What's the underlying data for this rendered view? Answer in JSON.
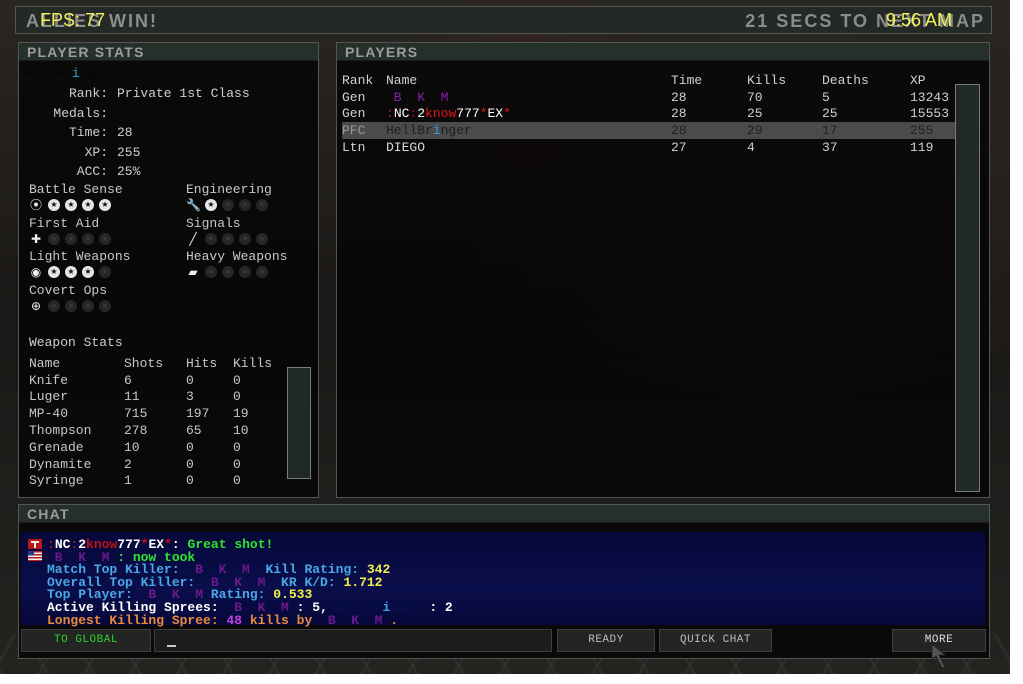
{
  "header": {
    "status_text": "ALLIES WIN!",
    "fps_label": "FPS:",
    "fps_value": "77",
    "next_map_text": "21 SECS TO NEXT MAP",
    "clock": "9:56 AM"
  },
  "player_stats": {
    "title": "PLAYER STATS",
    "player_name_hidden": "HellBr",
    "player_name_i": "i",
    "player_name_rest": "nger",
    "fields": [
      {
        "label": "Rank:",
        "value": "Private 1st Class"
      },
      {
        "label": "Medals:",
        "value": ""
      },
      {
        "label": "Time:",
        "value": "28"
      },
      {
        "label": "XP:",
        "value": "255"
      },
      {
        "label": "ACC:",
        "value": "25%"
      }
    ],
    "skills": [
      {
        "name": "Battle Sense",
        "icon": "radio-signal-icon",
        "glyph": "((•))",
        "level": 4,
        "max": 4
      },
      {
        "name": "Engineering",
        "icon": "wrench-icon",
        "glyph": "🔧",
        "level": 1,
        "max": 4
      },
      {
        "name": "First Aid",
        "icon": "medic-cross-icon",
        "glyph": "✚",
        "level": 0,
        "max": 4
      },
      {
        "name": "Signals",
        "icon": "flare-icon",
        "glyph": "╱",
        "level": 0,
        "max": 4
      },
      {
        "name": "Light Weapons",
        "icon": "pistol-icon",
        "glyph": "◉",
        "level": 3,
        "max": 4
      },
      {
        "name": "Heavy Weapons",
        "icon": "heavy-weapon-icon",
        "glyph": "▰",
        "level": 0,
        "max": 4
      },
      {
        "name": "Covert Ops",
        "icon": "crosshair-icon",
        "glyph": "⊕",
        "level": 0,
        "max": 4
      }
    ],
    "weapon_stats": {
      "title": "Weapon Stats",
      "columns": [
        "Name",
        "Shots",
        "Hits",
        "Kills"
      ],
      "rows": [
        [
          "Knife",
          "6",
          "0",
          "0"
        ],
        [
          "Luger",
          "11",
          "3",
          "0"
        ],
        [
          "MP-40",
          "715",
          "197",
          "19"
        ],
        [
          "Thompson",
          "278",
          "65",
          "10"
        ],
        [
          "Grenade",
          "10",
          "0",
          "0"
        ],
        [
          "Dynamite",
          "2",
          "0",
          "0"
        ],
        [
          "Syringe",
          "1",
          "0",
          "0"
        ]
      ]
    }
  },
  "players": {
    "title": "PLAYERS",
    "columns": [
      "Rank",
      "Name",
      "Time",
      "Kills",
      "Deaths",
      "XP"
    ],
    "rows": [
      {
        "rank": "Gen",
        "name_parts": [
          {
            "t": " B  K  M",
            "c": "#8a1fb0"
          }
        ],
        "time": "28",
        "kills": "70",
        "deaths": "5",
        "xp": "13243",
        "selected": false
      },
      {
        "rank": "Gen",
        "name_parts": [
          {
            "t": ":",
            "c": "#c01010"
          },
          {
            "t": "NC",
            "c": "#ffffff"
          },
          {
            "t": ":",
            "c": "#c01010"
          },
          {
            "t": "2",
            "c": "#ffffff"
          },
          {
            "t": "know",
            "c": "#e01818"
          },
          {
            "t": "777",
            "c": "#ffffff"
          },
          {
            "t": "*",
            "c": "#e01818"
          },
          {
            "t": "EX",
            "c": "#ffffff"
          },
          {
            "t": "*",
            "c": "#e01818"
          }
        ],
        "time": "28",
        "kills": "25",
        "deaths": "25",
        "xp": "15553",
        "selected": false
      },
      {
        "rank": "PFC",
        "name_parts": [
          {
            "t": "HellBr",
            "c": "#1e1e1e"
          },
          {
            "t": "i",
            "c": "#3aa0d8"
          },
          {
            "t": "nger",
            "c": "#1e1e1e"
          }
        ],
        "time": "28",
        "kills": "29",
        "deaths": "17",
        "xp": "255",
        "selected": true
      },
      {
        "rank": "Ltn",
        "name_parts": [
          {
            "t": "DIEGO",
            "c": "#d8d8d8"
          }
        ],
        "time": "27",
        "kills": "4",
        "deaths": "37",
        "xp": "119",
        "selected": false
      }
    ]
  },
  "chat": {
    "title": "CHAT",
    "lines": [
      {
        "parts": [
          {
            "t": ":",
            "c": "#c01010"
          },
          {
            "t": "NC",
            "c": "#ffffff"
          },
          {
            "t": ":",
            "c": "#c01010"
          },
          {
            "t": "2",
            "c": "#ffffff"
          },
          {
            "t": "know",
            "c": "#c01010"
          },
          {
            "t": "777",
            "c": "#ffffff"
          },
          {
            "t": "*",
            "c": "#c01010"
          },
          {
            "t": "EX",
            "c": "#ffffff"
          },
          {
            "t": "*",
            "c": "#c01010"
          },
          {
            "t": ": ",
            "c": "#ffffff"
          },
          {
            "t": "Great shot!",
            "c": "#2ee62e"
          }
        ]
      },
      {
        "parts": [
          {
            "t": " B  K  M ",
            "c": "#6a1a8a"
          },
          {
            "t": ": now took",
            "c": "#2ee62e"
          }
        ]
      },
      {
        "parts": [
          {
            "t": "Match Top Killer: ",
            "c": "#4aa8e8"
          },
          {
            "t": " B  K  M ",
            "c": "#6a1a8a"
          },
          {
            "t": " Kill Rating: ",
            "c": "#4aa8e8"
          },
          {
            "t": "342",
            "c": "#f2f24a"
          }
        ]
      },
      {
        "parts": [
          {
            "t": "Overall Top Killer: ",
            "c": "#4aa8e8"
          },
          {
            "t": " B  K  M ",
            "c": "#6a1a8a"
          },
          {
            "t": " KR K/D: ",
            "c": "#4aa8e8"
          },
          {
            "t": "1.712",
            "c": "#f2f24a"
          }
        ]
      },
      {
        "parts": [
          {
            "t": "Top Player: ",
            "c": "#4aa8e8"
          },
          {
            "t": " B  K  M ",
            "c": "#6a1a8a"
          },
          {
            "t": "Rating: ",
            "c": "#4aa8e8"
          },
          {
            "t": "0.533",
            "c": "#f2f24a"
          }
        ]
      },
      {
        "parts": [
          {
            "t": "Active Killing Sprees: ",
            "c": "#ffffff"
          },
          {
            "t": " B  K  M ",
            "c": "#6a1a8a"
          },
          {
            "t": ": 5, ",
            "c": "#ffffff"
          },
          {
            "t": "HellBr",
            "c": "#0a0e4a"
          },
          {
            "t": "i",
            "c": "#3aa0d8"
          },
          {
            "t": "nger",
            "c": "#0a0e4a"
          },
          {
            "t": " : 2",
            "c": "#ffffff"
          }
        ]
      },
      {
        "parts": [
          {
            "t": "Longest Killing Spree: ",
            "c": "#e88a3a"
          },
          {
            "t": "48",
            "c": "#c040e0"
          },
          {
            "t": " kills by ",
            "c": "#e88a3a"
          },
          {
            "t": " B  K  M ",
            "c": "#6a1a8a"
          },
          {
            "t": ".",
            "c": "#e88a3a"
          }
        ]
      }
    ],
    "buttons": {
      "to_global": "TO GLOBAL",
      "ready": "READY",
      "quick_chat": "QUICK CHAT",
      "more": "MORE"
    },
    "input_value": ""
  },
  "colors": {
    "hud_yellow": "#f2f25a",
    "panel_title_bg": "#26302b",
    "to_global_green": "#2ed02e"
  }
}
